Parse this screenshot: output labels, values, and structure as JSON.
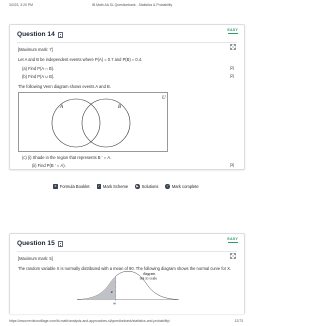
{
  "browser": {
    "datetime": "3/2/23, 3:20 PM",
    "tab_title": "IB Math AA SL Questionbank - Statistics & Probability",
    "url": "https://www.revisionvillage.com/ib-math/analysis-and-approaches-sl/questionbank/statistics-and-probability/",
    "page_count": "12/73"
  },
  "question14": {
    "title": "Question 14",
    "badge": "EASY",
    "marks_line": "[Maximum mark: 7]",
    "intro": "Let A and B be independent events where P(A) = 0.7 and P(B) = 0.4.",
    "part_a": "(a)  Find P(A ∩ B).",
    "part_a_marks": "[2]",
    "part_b": "(b)  Find P(A ∪ B).",
    "part_b_marks": "[2]",
    "venn_intro": "The following Venn diagram shows events A and B.",
    "venn_labels": {
      "universe": "U",
      "a": "A",
      "b": "B"
    },
    "part_c_i": "(c)   (i)  Shade in the region that represents B ′ ∩ A.",
    "part_c_ii": "(ii)  Find P(B ′ ∩ A).",
    "part_c_marks": "[3]"
  },
  "toolbar": {
    "formula_booklet": "Formula Booklet",
    "mark_scheme": "Mark Scheme",
    "solutions": "Solutions",
    "mark_complete": "Mark complete"
  },
  "question15": {
    "title": "Question 15",
    "badge": "EASY",
    "marks_line": "[Maximum mark: 5]",
    "intro": "The random variable X is normally distributed with a mean of 90. The following diagram shows the normal curve for X.",
    "diagram_note_line1": "diagram",
    "diagram_note_line2": "not to scale",
    "region_label": "R",
    "x_label": "84"
  },
  "colors": {
    "accent": "#2a9c69",
    "ink": "#1b2230",
    "icon": "#3b4352"
  },
  "icons": [
    "document-icon",
    "expand-icon",
    "formula-booklet-icon",
    "mark-scheme-icon",
    "solutions-icon",
    "mark-complete-icon"
  ]
}
